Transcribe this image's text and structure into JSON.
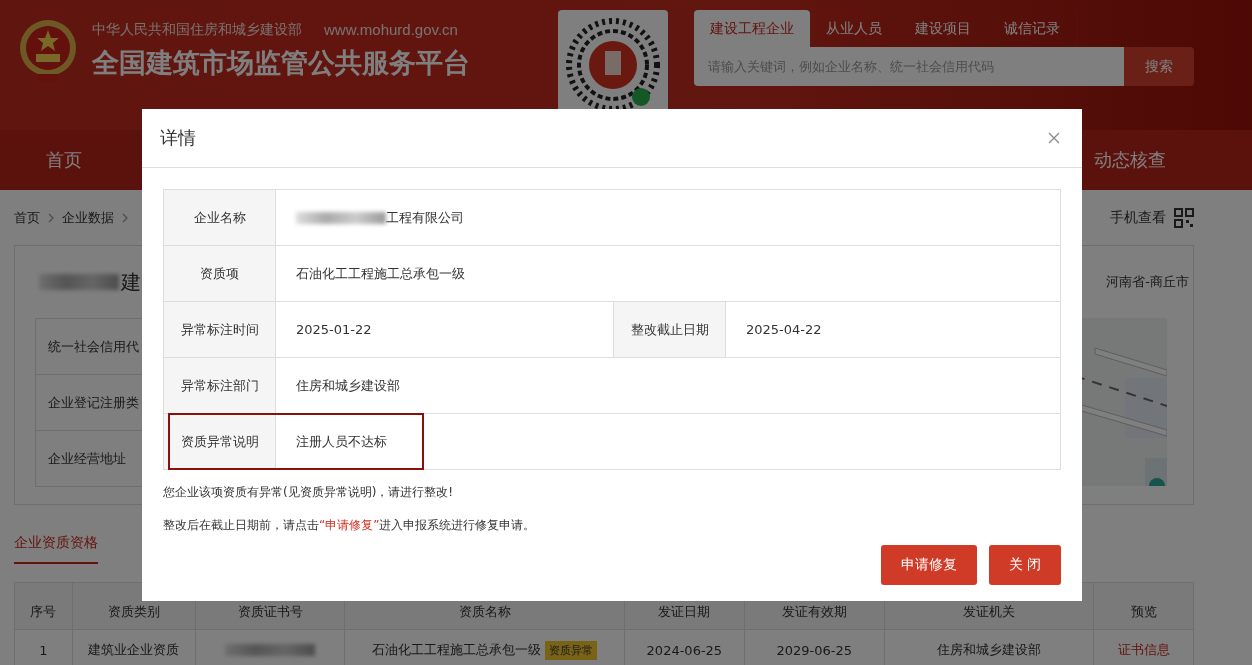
{
  "header": {
    "ministry": "中华人民共和国住房和城乡建设部",
    "url": "www.mohurd.gov.cn",
    "title": "全国建筑市场监管公共服务平台",
    "search_tabs": [
      {
        "label": "建设工程企业",
        "selected": true
      },
      {
        "label": "从业人员",
        "selected": false
      },
      {
        "label": "建设项目",
        "selected": false
      },
      {
        "label": "诚信记录",
        "selected": false
      }
    ],
    "search": {
      "placeholder": "请输入关键词，例如企业名称、统一社会信用代码"
    },
    "search_button": "搜索"
  },
  "nav": [
    {
      "label": "首页"
    },
    {
      "label": "动态核查"
    }
  ],
  "breadcrumb": [
    "首页",
    "企业数据"
  ],
  "mobile_view": "手机查看",
  "company_card": {
    "name": {
      "redacted": true,
      "text": "建"
    },
    "info_labels": [
      "统一社会信用代",
      "企业登记注册类",
      "企业经营地址"
    ],
    "region": "河南省-商丘市"
  },
  "section_tabs": [
    {
      "label": "企业资质资格",
      "selected": true
    }
  ],
  "table": {
    "columns": [
      "序号",
      "资质类别",
      "资质证书号",
      "资质名称",
      "发证日期",
      "发证有效期",
      "发证机关",
      "预览"
    ],
    "rows": [
      {
        "cells": [
          {
            "text": "1"
          },
          {
            "text": "建筑业企业资质"
          },
          {
            "redacted": true
          },
          {
            "text": "石油化工工程施工总承包一级",
            "badge": "资质异常"
          },
          {
            "text": "2024-06-25"
          },
          {
            "text": "2029-06-25"
          },
          {
            "text": "住房和城乡建设部"
          },
          {
            "text": "证书信息",
            "link": true
          }
        ]
      }
    ]
  },
  "dialog": {
    "title": "详情",
    "rows": [
      {
        "highlighted": false,
        "fields": [
          {
            "label": "企业名称",
            "value": "工程有限公司",
            "redacted": true
          }
        ]
      },
      {
        "highlighted": false,
        "fields": [
          {
            "label": "资质项",
            "value": "石油化工工程施工总承包一级",
            "redacted": false
          }
        ]
      },
      {
        "highlighted": false,
        "fields": [
          {
            "label": "异常标注时间",
            "value": "2025-01-22",
            "redacted": false
          },
          {
            "label": "整改截止日期",
            "value": "2025-04-22",
            "redacted": false
          }
        ]
      },
      {
        "highlighted": false,
        "fields": [
          {
            "label": "异常标注部门",
            "value": "住房和城乡建设部",
            "redacted": false
          }
        ]
      },
      {
        "highlighted": true,
        "fields": [
          {
            "label": "资质异常说明",
            "value": "注册人员不达标",
            "redacted": false
          }
        ]
      }
    ],
    "notice": "您企业该项资质有异常(见资质异常说明)，请进行整改!",
    "instruction": {
      "before": "整改后在截止日期前，请点击",
      "link": "“申请修复”",
      "after": "进入申报系统进行修复申请。"
    },
    "buttons": [
      {
        "label": "申请修复",
        "kind": "primary"
      },
      {
        "label": "关 闭",
        "kind": "primary"
      }
    ]
  }
}
